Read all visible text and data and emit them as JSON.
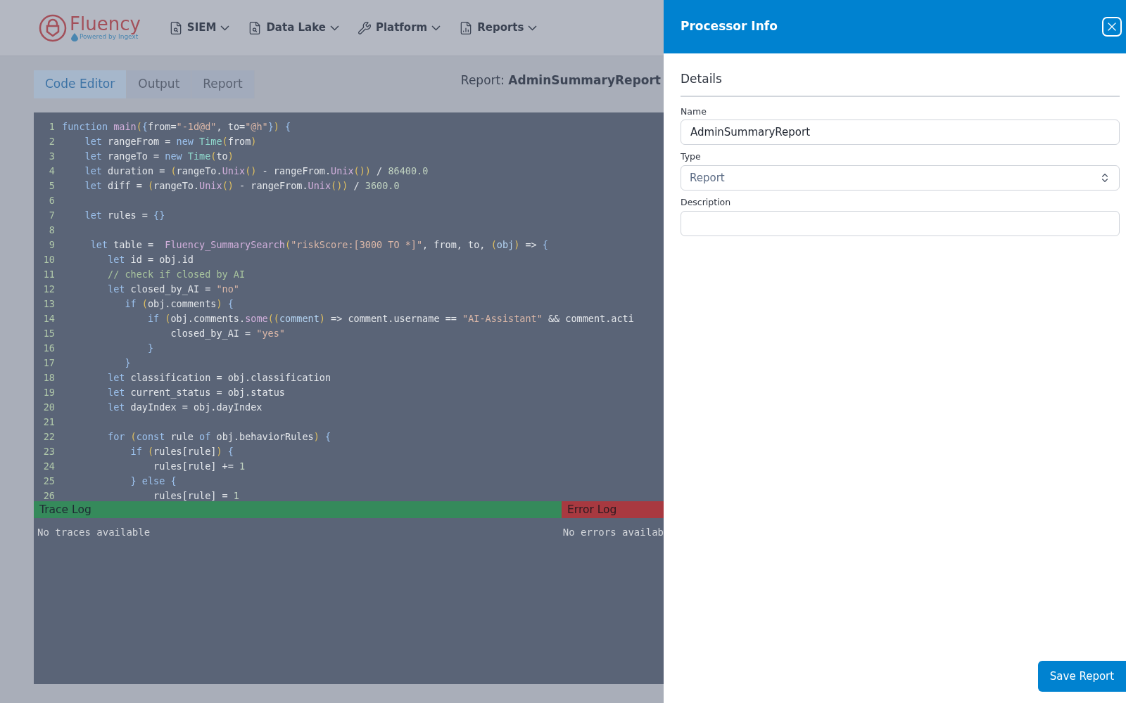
{
  "logo": {
    "name": "Fluency",
    "tagline": "Powered by Ingext"
  },
  "nav": [
    {
      "label": "SIEM",
      "kind": "search-doc"
    },
    {
      "label": "Data Lake",
      "kind": "search-doc"
    },
    {
      "label": "Platform",
      "kind": "wrench"
    },
    {
      "label": "Reports",
      "kind": "chart-doc"
    }
  ],
  "tabs": [
    {
      "label": "Code Editor",
      "selected": true
    },
    {
      "label": "Output",
      "selected": false
    },
    {
      "label": "Report",
      "selected": false
    }
  ],
  "report": {
    "label": "Report:",
    "name": "AdminSummaryReport"
  },
  "code": [
    {
      "n": "1",
      "tokens": [
        {
          "kind": "kw",
          "text": "function "
        },
        {
          "kind": "fn",
          "text": "main"
        },
        {
          "kind": "p",
          "text": "("
        },
        {
          "kind": "b",
          "text": "{"
        },
        {
          "kind": "t",
          "text": "from="
        },
        {
          "kind": "str",
          "text": "\"-1d@d\""
        },
        {
          "kind": "t",
          "text": ", to="
        },
        {
          "kind": "str",
          "text": "\"@h\""
        },
        {
          "kind": "b",
          "text": "}"
        },
        {
          "kind": "p",
          "text": ") "
        },
        {
          "kind": "b",
          "text": "{"
        }
      ]
    },
    {
      "n": "2",
      "tokens": [
        {
          "kind": "kw",
          "text": "    let"
        },
        {
          "kind": "t",
          "text": " rangeFrom = "
        },
        {
          "kind": "kw",
          "text": "new "
        },
        {
          "kind": "ty",
          "text": "Time"
        },
        {
          "kind": "p",
          "text": "("
        },
        {
          "kind": "t",
          "text": "from"
        },
        {
          "kind": "p",
          "text": ")"
        }
      ]
    },
    {
      "n": "3",
      "tokens": [
        {
          "kind": "kw",
          "text": "    let"
        },
        {
          "kind": "t",
          "text": " rangeTo = "
        },
        {
          "kind": "kw",
          "text": "new "
        },
        {
          "kind": "ty",
          "text": "Time"
        },
        {
          "kind": "p",
          "text": "("
        },
        {
          "kind": "t",
          "text": "to"
        },
        {
          "kind": "p",
          "text": ")"
        }
      ]
    },
    {
      "n": "4",
      "tokens": [
        {
          "kind": "kw",
          "text": "    let"
        },
        {
          "kind": "t",
          "text": " duration = "
        },
        {
          "kind": "p",
          "text": "("
        },
        {
          "kind": "t",
          "text": "rangeTo."
        },
        {
          "kind": "fn",
          "text": "Unix"
        },
        {
          "kind": "p",
          "text": "()"
        },
        {
          "kind": "t",
          "text": " - rangeFrom."
        },
        {
          "kind": "fn",
          "text": "Unix"
        },
        {
          "kind": "p",
          "text": "())"
        },
        {
          "kind": "t",
          "text": " / "
        },
        {
          "kind": "num",
          "text": "86400.0"
        }
      ]
    },
    {
      "n": "5",
      "tokens": [
        {
          "kind": "kw",
          "text": "    let"
        },
        {
          "kind": "t",
          "text": " diff = "
        },
        {
          "kind": "p",
          "text": "("
        },
        {
          "kind": "t",
          "text": "rangeTo."
        },
        {
          "kind": "fn",
          "text": "Unix"
        },
        {
          "kind": "p",
          "text": "()"
        },
        {
          "kind": "t",
          "text": " - rangeFrom."
        },
        {
          "kind": "fn",
          "text": "Unix"
        },
        {
          "kind": "p",
          "text": "())"
        },
        {
          "kind": "t",
          "text": " / "
        },
        {
          "kind": "num",
          "text": "3600.0"
        }
      ]
    },
    {
      "n": "6"
    },
    {
      "n": "7",
      "tokens": [
        {
          "kind": "kw",
          "text": "    let"
        },
        {
          "kind": "t",
          "text": " rules = "
        },
        {
          "kind": "b",
          "text": "{}"
        }
      ]
    },
    {
      "n": "8"
    },
    {
      "n": "9",
      "tokens": [
        {
          "kind": "kw",
          "text": "     let"
        },
        {
          "kind": "t",
          "text": " table =  "
        },
        {
          "kind": "fn",
          "text": "Fluency_SummarySearch"
        },
        {
          "kind": "p",
          "text": "("
        },
        {
          "kind": "str",
          "text": "\"riskScore:[3000 TO *]\""
        },
        {
          "kind": "t",
          "text": ", from, to, "
        },
        {
          "kind": "p",
          "text": "("
        },
        {
          "kind": "ob",
          "text": "obj"
        },
        {
          "kind": "p",
          "text": ")"
        },
        {
          "kind": "t",
          "text": " => "
        },
        {
          "kind": "b",
          "text": "{"
        }
      ]
    },
    {
      "n": "10",
      "tokens": [
        {
          "kind": "kw",
          "text": "        let"
        },
        {
          "kind": "t",
          "text": " id = obj.id"
        }
      ]
    },
    {
      "n": "11",
      "tokens": [
        {
          "kind": "cm",
          "text": "        // check if closed by AI"
        }
      ]
    },
    {
      "n": "12",
      "tokens": [
        {
          "kind": "kw",
          "text": "        let"
        },
        {
          "kind": "t",
          "text": " closed_by_AI = "
        },
        {
          "kind": "str",
          "text": "\"no\""
        }
      ]
    },
    {
      "n": "13",
      "tokens": [
        {
          "kind": "kw",
          "text": "           if "
        },
        {
          "kind": "p",
          "text": "("
        },
        {
          "kind": "t",
          "text": "obj.comments"
        },
        {
          "kind": "p",
          "text": ") "
        },
        {
          "kind": "b",
          "text": "{"
        }
      ]
    },
    {
      "n": "14",
      "tokens": [
        {
          "kind": "kw",
          "text": "               if "
        },
        {
          "kind": "p",
          "text": "("
        },
        {
          "kind": "t",
          "text": "obj.comments."
        },
        {
          "kind": "fn",
          "text": "some"
        },
        {
          "kind": "p",
          "text": "(("
        },
        {
          "kind": "ob",
          "text": "comment"
        },
        {
          "kind": "p",
          "text": ")"
        },
        {
          "kind": "t",
          "text": " => comment.username == "
        },
        {
          "kind": "str",
          "text": "\"AI-Assistant\""
        },
        {
          "kind": "t",
          "text": " && comment.acti"
        }
      ]
    },
    {
      "n": "15",
      "tokens": [
        {
          "kind": "t",
          "text": "                   closed_by_AI = "
        },
        {
          "kind": "str",
          "text": "\"yes\""
        }
      ]
    },
    {
      "n": "16",
      "tokens": [
        {
          "kind": "b",
          "text": "               }"
        }
      ]
    },
    {
      "n": "17",
      "tokens": [
        {
          "kind": "b",
          "text": "           }"
        }
      ]
    },
    {
      "n": "18",
      "tokens": [
        {
          "kind": "kw",
          "text": "        let"
        },
        {
          "kind": "t",
          "text": " classification = obj.classification"
        }
      ]
    },
    {
      "n": "19",
      "tokens": [
        {
          "kind": "kw",
          "text": "        let"
        },
        {
          "kind": "t",
          "text": " current_status = obj.status"
        }
      ]
    },
    {
      "n": "20",
      "tokens": [
        {
          "kind": "kw",
          "text": "        let"
        },
        {
          "kind": "t",
          "text": " dayIndex = obj.dayIndex"
        }
      ]
    },
    {
      "n": "21"
    },
    {
      "n": "22",
      "tokens": [
        {
          "kind": "kw",
          "text": "        for "
        },
        {
          "kind": "p",
          "text": "("
        },
        {
          "kind": "kw",
          "text": "const"
        },
        {
          "kind": "t",
          "text": " rule "
        },
        {
          "kind": "kw",
          "text": "of"
        },
        {
          "kind": "t",
          "text": " obj.behaviorRules"
        },
        {
          "kind": "p",
          "text": ") "
        },
        {
          "kind": "b",
          "text": "{"
        }
      ]
    },
    {
      "n": "23",
      "tokens": [
        {
          "kind": "kw",
          "text": "            if "
        },
        {
          "kind": "p",
          "text": "("
        },
        {
          "kind": "t",
          "text": "rules[rule]"
        },
        {
          "kind": "p",
          "text": ") "
        },
        {
          "kind": "b",
          "text": "{"
        }
      ]
    },
    {
      "n": "24",
      "tokens": [
        {
          "kind": "t",
          "text": "                rules[rule] += "
        },
        {
          "kind": "num",
          "text": "1"
        }
      ]
    },
    {
      "n": "25",
      "tokens": [
        {
          "kind": "b",
          "text": "            } else {"
        }
      ]
    },
    {
      "n": "26",
      "tokens": [
        {
          "kind": "t",
          "text": "                rules[rule] = "
        },
        {
          "kind": "num",
          "text": "1"
        }
      ]
    }
  ],
  "trace_log": {
    "title": "Trace Log",
    "message": "No traces available"
  },
  "error_log": {
    "title": "Error Log",
    "message": "No errors availab"
  },
  "drawer": {
    "title": "Processor Info",
    "section": "Details",
    "fields": [
      {
        "label": "Name",
        "kind": "text",
        "value": "AdminSummaryReport"
      },
      {
        "label": "Type",
        "kind": "select",
        "value": "Report"
      },
      {
        "label": "Description",
        "kind": "text"
      }
    ],
    "save_button": "Save Report"
  }
}
